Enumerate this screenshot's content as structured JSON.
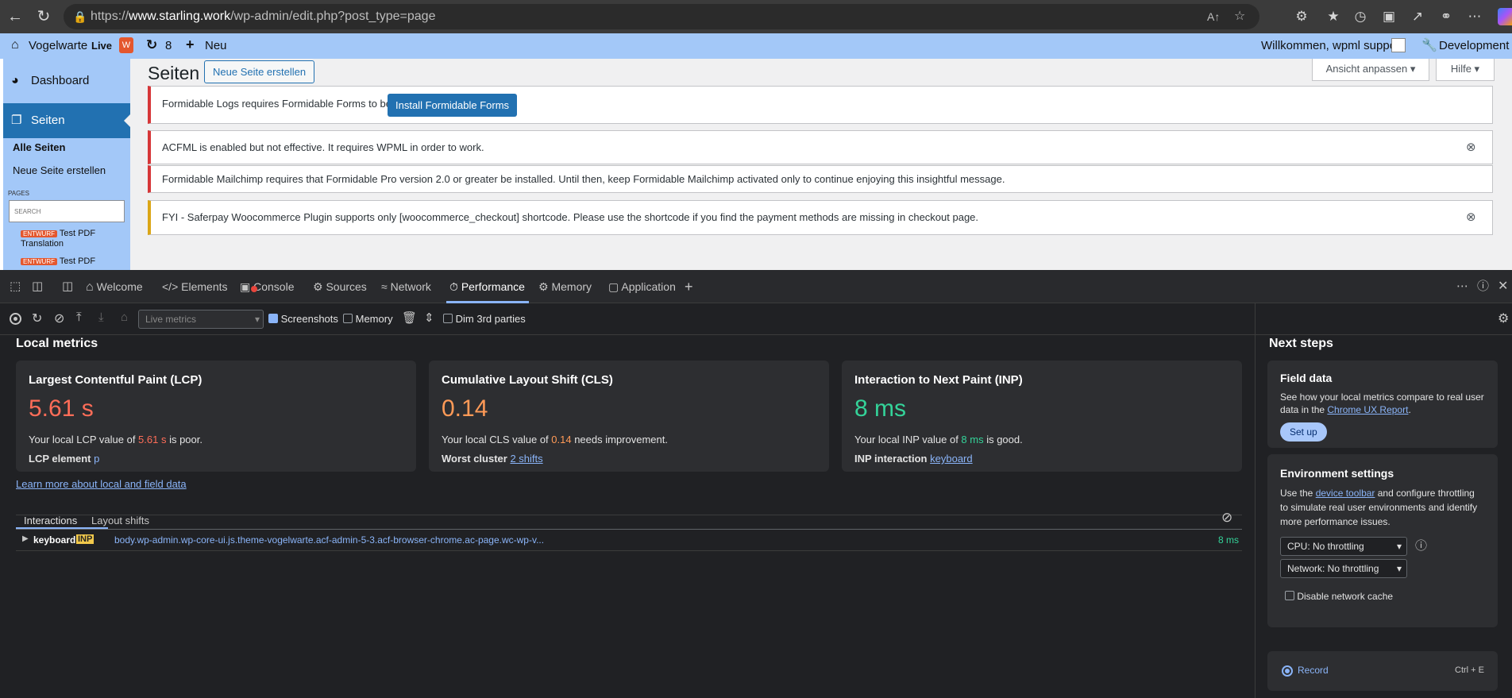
{
  "browser": {
    "url_prefix": "https://",
    "url_host": "www.starling.work",
    "url_path": "/wp-admin/edit.php?post_type=page"
  },
  "adminbar": {
    "site_name": "Vogelwarte",
    "live": "Live",
    "updates": "8",
    "new": "Neu",
    "welcome": "Willkommen, wpml support",
    "environment": "Development"
  },
  "sidebar": {
    "dashboard": "Dashboard",
    "pages": "Seiten",
    "all_pages": "Alle Seiten",
    "new_page": "Neue Seite erstellen",
    "section": "PAGES",
    "search_placeholder": "SEARCH",
    "items": [
      {
        "badge": "ENTWURF",
        "title": "Test PDF",
        "title2": "Translation"
      },
      {
        "badge": "ENTWURF",
        "title": "Test PDF"
      }
    ]
  },
  "main": {
    "title": "Seiten",
    "add_new": "Neue Seite erstellen",
    "screen_options": "Ansicht anpassen",
    "help": "Hilfe",
    "notices": [
      {
        "text": "Formidable Logs requires Formidable Forms to be installed.",
        "button": "Install Formidable Forms"
      },
      {
        "text": "ACFML is enabled but not effective. It requires WPML in order to work."
      },
      {
        "text": "Formidable Mailchimp requires that Formidable Pro version 2.0 or greater be installed. Until then, keep Formidable Mailchimp activated only to continue enjoying this insightful message."
      },
      {
        "text": "FYI - Saferpay Woocommerce Plugin supports only [woocommerce_checkout] shortcode. Please use the shortcode if you find the payment methods are missing in checkout page."
      }
    ]
  },
  "devtools": {
    "tabs": [
      "Welcome",
      "Elements",
      "Console",
      "Sources",
      "Network",
      "Performance",
      "Memory",
      "Application"
    ],
    "toolbar": {
      "live_metrics": "Live metrics",
      "screenshots": "Screenshots",
      "memory": "Memory",
      "dim": "Dim 3rd parties"
    },
    "local_metrics": "Local metrics",
    "lcp": {
      "title": "Largest Contentful Paint (LCP)",
      "value": "5.61 s",
      "desc_pre": "Your local LCP value of ",
      "desc_val": "5.61 s",
      "desc_post": " is poor.",
      "label": "LCP element",
      "link": "p"
    },
    "cls": {
      "title": "Cumulative Layout Shift (CLS)",
      "value": "0.14",
      "desc_pre": "Your local CLS value of ",
      "desc_val": "0.14",
      "desc_post": " needs improvement.",
      "label": "Worst cluster",
      "link": "2 shifts"
    },
    "inp": {
      "title": "Interaction to Next Paint (INP)",
      "value": "8 ms",
      "desc_pre": "Your local INP value of ",
      "desc_val": "8 ms",
      "desc_post": " is good.",
      "label": "INP interaction",
      "link": "keyboard"
    },
    "learn_more": "Learn more about local and field data",
    "subtabs": [
      "Interactions",
      "Layout shifts"
    ],
    "row": {
      "type": "keyboard",
      "badge": "INP",
      "target": "body.wp-admin.wp-core-ui.js.theme-vogelwarte.acf-admin-5-3.acf-browser-chrome.ac-page.wc-wp-v...",
      "time": "8 ms"
    },
    "next_steps": {
      "title": "Next steps",
      "field_title": "Field data",
      "field_desc1": "See how your local metrics compare to real user",
      "field_desc2_pre": "data in the ",
      "field_link": "Chrome UX Report",
      "field_desc2_post": ".",
      "setup": "Set up",
      "env_title": "Environment settings",
      "env_pre": "Use the ",
      "env_link": "device toolbar",
      "env_post": " and configure throttling",
      "env_line2": "to simulate real user environments and identify",
      "env_line3": "more performance issues.",
      "cpu": "CPU: No throttling",
      "network": "Network: No throttling",
      "disable_cache": "Disable network cache",
      "record": "Record",
      "shortcut": "Ctrl + E"
    }
  },
  "colors": {
    "poor": "#ff6d58",
    "needs": "#ff9a57",
    "good": "#34d399",
    "accent": "#2271b1"
  }
}
